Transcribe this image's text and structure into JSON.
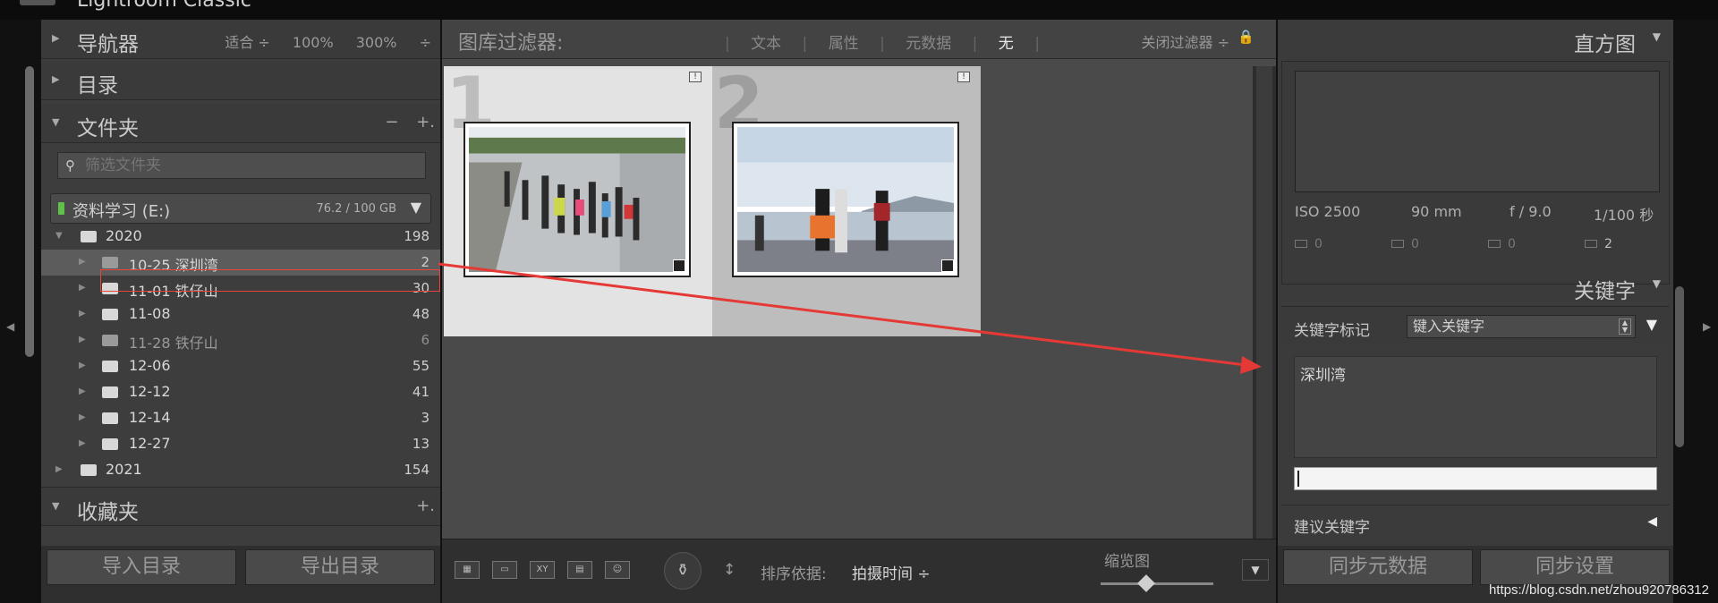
{
  "app": {
    "title": "Lightroom Classic"
  },
  "navigator": {
    "title": "导航器",
    "options": [
      "适合 ÷",
      "100%",
      "300%",
      "÷"
    ]
  },
  "catalog": {
    "title": "目录"
  },
  "folders": {
    "title": "文件夹",
    "tools": [
      "−",
      "+."
    ],
    "search_placeholder": "筛选文件夹",
    "volume": {
      "name": "资料学习 (E:)",
      "capacity": "76.2 / 100 GB",
      "status_color": "#5fc04a"
    },
    "tree": [
      {
        "name": "2020",
        "count": "198"
      },
      {
        "name": "10-25 深圳湾",
        "count": "2"
      },
      {
        "name": "11-01  铁仔山",
        "count": "30"
      },
      {
        "name": "11-08",
        "count": "48"
      },
      {
        "name": "11-28 铁仔山",
        "count": "6"
      },
      {
        "name": "12-06",
        "count": "55"
      },
      {
        "name": "12-12",
        "count": "41"
      },
      {
        "name": "12-14",
        "count": "3"
      },
      {
        "name": "12-27",
        "count": "13"
      },
      {
        "name": "2021",
        "count": "154"
      }
    ]
  },
  "collections": {
    "title": "收藏夹",
    "tool": "+."
  },
  "left_buttons": {
    "import": "导入目录",
    "export": "导出目录"
  },
  "filter_bar": {
    "label": "图库过滤器:",
    "options": [
      "文本",
      "属性",
      "元数据",
      "无"
    ],
    "active": "无",
    "close": "关闭过滤器 ÷"
  },
  "grid": {
    "cells": [
      {
        "index": "1",
        "flag": "!"
      },
      {
        "index": "2",
        "flag": "!"
      }
    ]
  },
  "toolbar": {
    "sort_label": "排序依据:",
    "sort_value": "拍摄时间 ÷",
    "thumb_label": "缩览图",
    "view_icons": [
      "grid-view-icon",
      "loupe-view-icon",
      "compare-view-icon",
      "survey-view-icon",
      "people-view-icon"
    ],
    "compare_text": "XY"
  },
  "histogram": {
    "title": "直方图",
    "exif": {
      "iso": "ISO 2500",
      "focal": "90 mm",
      "aperture": "f / 9.0",
      "shutter": "1/100 秒"
    },
    "clip": [
      "0",
      "0",
      "0",
      "2"
    ]
  },
  "keywords": {
    "title": "关键字",
    "tag_label": "关键字标记",
    "tag_select": "键入关键字",
    "tag_value": "深圳湾",
    "suggest_label": "建议关键字"
  },
  "right_buttons": {
    "sync_meta": "同步元数据",
    "sync_settings": "同步设置"
  },
  "watermark": "https://blog.csdn.net/zhou920786312",
  "colors": {
    "highlight_box": "#e8443a",
    "arrow": "#e53935"
  }
}
